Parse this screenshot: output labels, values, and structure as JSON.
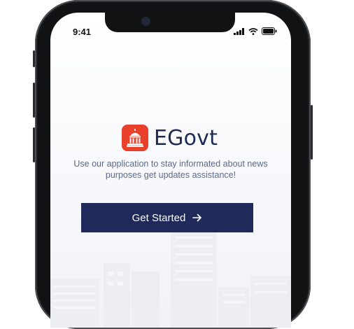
{
  "status_bar": {
    "time": "9:41"
  },
  "app": {
    "title": "EGovt",
    "tagline": "Use our application to stay informated about news purposes get updates assistance!",
    "cta_label": "Get Started"
  },
  "colors": {
    "brand_red": "#e8402b",
    "navy": "#1f2a5a",
    "title_text": "#1f2a52",
    "tagline_text": "#5a6a8e"
  },
  "icons": {
    "logo": "capitol-building-icon",
    "cta": "arrow-right-icon",
    "signal": "signal-icon",
    "wifi": "wifi-icon",
    "battery": "battery-icon"
  }
}
